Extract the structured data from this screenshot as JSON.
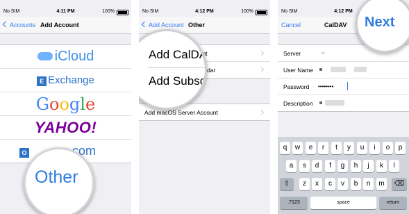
{
  "panel1": {
    "status": {
      "carrier": "No SIM",
      "time": "4:11 PM",
      "battery": "100%"
    },
    "nav": {
      "back": "Accounts",
      "title": "Add Account"
    },
    "accounts": [
      "iCloud",
      "Exchange",
      "Google",
      "YAHOO!",
      "Outlook.com"
    ],
    "outlook_visible_suffix": "com",
    "magnified_label": "Other"
  },
  "panel2": {
    "status": {
      "carrier": "No SIM",
      "time": "4:12 PM",
      "battery": "100%"
    },
    "nav": {
      "back": "Add Account",
      "title": "Other"
    },
    "rows": [
      "Add CalDAV Account",
      "Add Subscribed Calendar"
    ],
    "row_visible_tails": [
      "ount",
      "alendar"
    ],
    "server_row": "Add macOS Server Account",
    "magnified": {
      "line1": "Add CalDAV",
      "line2": "Add Subscr"
    }
  },
  "panel3": {
    "status": {
      "carrier": "No SIM",
      "time": "4:12 PM"
    },
    "nav": {
      "cancel": "Cancel",
      "title": "CalDAV",
      "next": "Next"
    },
    "fields": [
      {
        "label": "Server",
        "value": ""
      },
      {
        "label": "User Name",
        "value": ""
      },
      {
        "label": "Password",
        "value": "••••••••"
      },
      {
        "label": "Description",
        "value": ""
      }
    ],
    "keyboard": {
      "row1": [
        "q",
        "w",
        "e",
        "r",
        "t",
        "y",
        "u",
        "i",
        "o",
        "p"
      ],
      "row2": [
        "a",
        "s",
        "d",
        "f",
        "g",
        "h",
        "j",
        "k",
        "l"
      ],
      "row3": [
        "z",
        "x",
        "c",
        "v",
        "b",
        "n",
        "m"
      ],
      "shift": "⇧",
      "delete": "⌫",
      "numbers": ".?123",
      "space": "space",
      "return": "return"
    }
  },
  "colors": {
    "accent": "#3478f6",
    "yahoo": "#7b0099",
    "background": "#efeff4"
  }
}
